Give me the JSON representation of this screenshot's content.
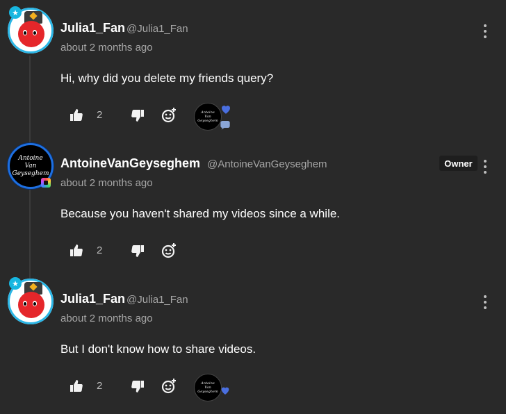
{
  "comments": [
    {
      "name": "Julia1_Fan",
      "handle": "@Julia1_Fan",
      "time": "about 2 months ago",
      "text": "Hi, why did you delete my friends query?",
      "likes": "2",
      "avatar_icon": "countryball-avatar",
      "creator_reaction": {
        "heart": true,
        "replied": true
      },
      "creator_avatar_text": "Antoine\nVan\nGeyseghem"
    },
    {
      "name": "AntoineVanGeyseghem",
      "handle": "@AntoineVanGeyseghem",
      "time": "about 2 months ago",
      "text": "Because you haven't shared my videos since a while.",
      "likes": "2",
      "badge": "Owner",
      "avatar_text": "Antoine\nVan\nGeyseghem"
    },
    {
      "name": "Julia1_Fan",
      "handle": "@Julia1_Fan",
      "time": "about 2 months ago",
      "text": "But I don't know how to share videos.",
      "likes": "2",
      "avatar_icon": "countryball-avatar",
      "creator_reaction": {
        "heart": true,
        "replied": false
      },
      "creator_avatar_text": "Antoine\nVan\nGeyseghem"
    }
  ],
  "colors": {
    "background": "#292929",
    "text": "#ffffff",
    "muted": "#a6a6a6",
    "accent_blue": "#1e6fe0",
    "heart": "#4a6fe0"
  }
}
